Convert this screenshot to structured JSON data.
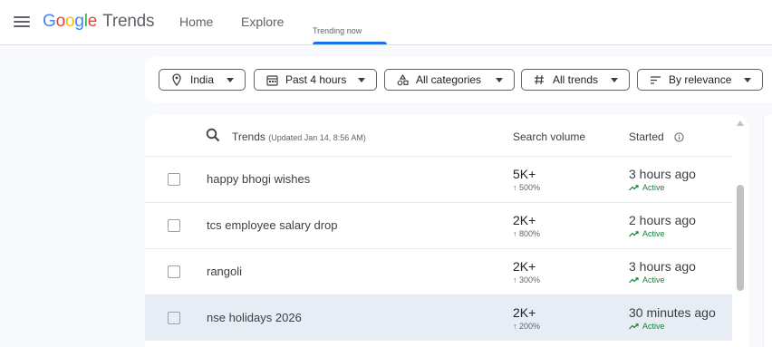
{
  "app": {
    "logo_parts": [
      "G",
      "o",
      "o",
      "g",
      "l",
      "e"
    ],
    "logo_suffix": "Trends"
  },
  "nav": {
    "tabs": [
      {
        "label": "Home"
      },
      {
        "label": "Explore"
      },
      {
        "label": "Trending now"
      }
    ],
    "active_tab": "Trending now"
  },
  "filters": {
    "location": {
      "label": "India",
      "icon": "location-pin-icon"
    },
    "time": {
      "label": "Past 4 hours",
      "icon": "calendar-icon"
    },
    "category": {
      "label": "All categories",
      "icon": "categories-icon"
    },
    "trend_type": {
      "label": "All trends",
      "icon": "hashtag-icon"
    },
    "sort": {
      "label": "By relevance",
      "icon": "sort-icon"
    }
  },
  "table": {
    "header": {
      "trends": "Trends",
      "updated": "(Updated Jan 14, 8:56 AM)",
      "search_volume": "Search volume",
      "started": "Started"
    },
    "rows": [
      {
        "term": "happy bhogi wishes",
        "volume": "5K+",
        "change": "↑ 500%",
        "started": "3 hours ago",
        "status": "Active",
        "highlighted": false
      },
      {
        "term": "tcs employee salary drop",
        "volume": "2K+",
        "change": "↑ 800%",
        "started": "2 hours ago",
        "status": "Active",
        "highlighted": false
      },
      {
        "term": "rangoli",
        "volume": "2K+",
        "change": "↑ 300%",
        "started": "3 hours ago",
        "status": "Active",
        "highlighted": false
      },
      {
        "term": "nse holidays 2026",
        "volume": "2K+",
        "change": "↑ 200%",
        "started": "30 minutes ago",
        "status": "Active",
        "highlighted": true
      }
    ]
  },
  "colors": {
    "accent": "#1a73e8",
    "active_green": "#188038",
    "highlight_row": "#e8edf5"
  }
}
